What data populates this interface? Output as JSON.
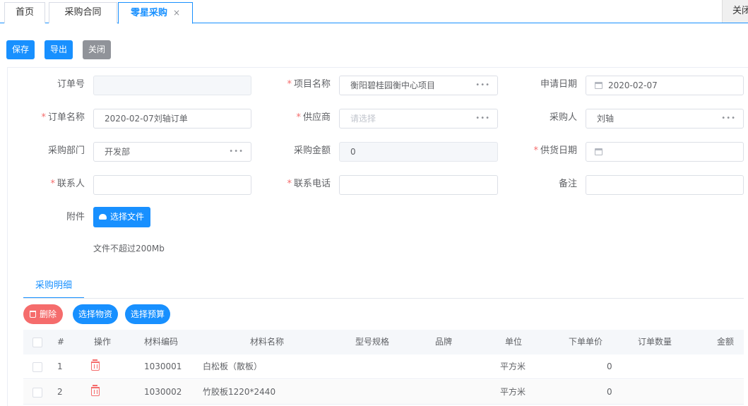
{
  "tabs": [
    {
      "label": "首页"
    },
    {
      "label": "采购合同"
    },
    {
      "label": "零星采购",
      "close": "×"
    }
  ],
  "close_all_label": "关闭",
  "toolbar": {
    "save": "保存",
    "export": "导出",
    "close": "关闭"
  },
  "form": {
    "order_no": {
      "label": "订单号",
      "value": ""
    },
    "project_name": {
      "label": "项目名称",
      "value": "衡阳碧桂园衡中心项目"
    },
    "apply_date": {
      "label": "申请日期",
      "value": "2020-02-07"
    },
    "order_name": {
      "label": "订单名称",
      "value": "2020-02-07刘轴订单"
    },
    "supplier": {
      "label": "供应商",
      "placeholder": "请选择"
    },
    "buyer": {
      "label": "采购人",
      "value": "刘轴"
    },
    "dept": {
      "label": "采购部门",
      "value": "开发部"
    },
    "amount": {
      "label": "采购金额",
      "value": "0"
    },
    "supply_date": {
      "label": "供货日期",
      "value": ""
    },
    "contact": {
      "label": "联系人",
      "value": ""
    },
    "phone": {
      "label": "联系电话",
      "value": ""
    },
    "remark": {
      "label": "备注",
      "value": ""
    },
    "attachment": {
      "label": "附件",
      "button": "选择文件",
      "hint": "文件不超过200Mb"
    },
    "required_mark": "*"
  },
  "detail": {
    "tab_label": "采购明细",
    "delete_button": "删除",
    "select_material_button": "选择物资",
    "select_budget_button": "选择预算",
    "columns": [
      "#",
      "操作",
      "材料编码",
      "材料名称",
      "型号规格",
      "品牌",
      "单位",
      "下单单价",
      "订单数量",
      "金额"
    ],
    "rows": [
      {
        "index": "1",
        "code": "1030001",
        "name": "白松板（散板）",
        "spec": "",
        "brand": "",
        "unit": "平方米",
        "price": "0",
        "qty": "",
        "amount": ""
      },
      {
        "index": "2",
        "code": "1030002",
        "name": "竹胶板1220*2440",
        "spec": "",
        "brand": "",
        "unit": "平方米",
        "price": "0",
        "qty": "",
        "amount": ""
      }
    ]
  },
  "colors": {
    "primary": "#1890ff",
    "danger": "#f56c6c",
    "gray_button": "#909399"
  },
  "icons": [
    "close-icon",
    "ellipsis-icon",
    "calendar-icon",
    "cloud-upload-icon",
    "trash-icon",
    "checkbox-icon"
  ]
}
